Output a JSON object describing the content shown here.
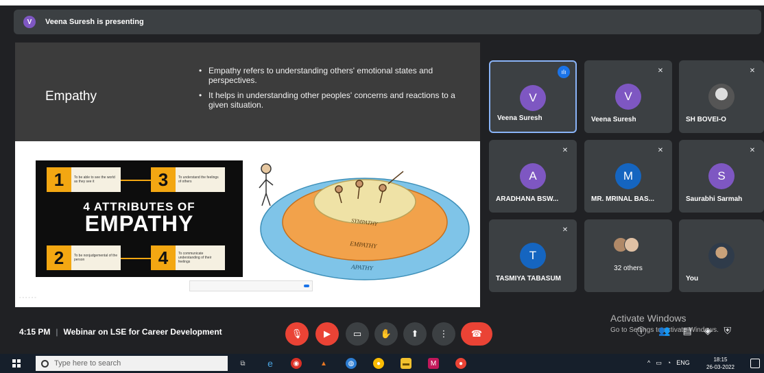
{
  "presenting": {
    "avatar_letter": "V",
    "text": "Veena Suresh is presenting"
  },
  "slide": {
    "title": "Empathy",
    "bullets": [
      "Empathy refers to understanding others' emotional states and perspectives.",
      "It helps in understanding other peoples' concerns and reactions to a given situation."
    ],
    "poster": {
      "line1": "4 ATTRIBUTES OF",
      "line2": "EMPATHY",
      "items": [
        {
          "num": "1",
          "text": "To be able to see the world as they see it"
        },
        {
          "num": "2",
          "text": "To be nonjudgemental of the person"
        },
        {
          "num": "3",
          "text": "To understand the feelings of others"
        },
        {
          "num": "4",
          "text": "To communicate understanding of their feelings"
        }
      ]
    },
    "circles": {
      "inner": "SYMPATHY",
      "middle": "EMPATHY",
      "outer": "APATHY"
    }
  },
  "participants": [
    {
      "name": "Veena Suresh",
      "letter": "V",
      "color": "#7e57c2",
      "active": true
    },
    {
      "name": "Veena Suresh",
      "letter": "V",
      "color": "#7e57c2"
    },
    {
      "name": "SH BOVEI-O",
      "letter": "",
      "photo": true
    },
    {
      "name": "ARADHANA BSW...",
      "letter": "A",
      "color": "#7e57c2"
    },
    {
      "name": "MR. MRINAL BAS...",
      "letter": "M",
      "color": "#1565c0"
    },
    {
      "name": "Saurabhi Sarmah",
      "letter": "S",
      "color": "#7e57c2"
    },
    {
      "name": "TASMIYA TABASUM",
      "letter": "T",
      "color": "#1565c0"
    },
    {
      "name": "32 others"
    },
    {
      "name": "You",
      "photo": true
    }
  ],
  "meeting": {
    "time": "4:15 PM",
    "title": "Webinar on LSE for Career Development"
  },
  "watermark": {
    "line1": "Activate Windows",
    "line2": "Go to Settings to activate Windows."
  },
  "taskbar": {
    "search_placeholder": "Type here to search",
    "lang": "ENG",
    "time": "18:15",
    "date": "26-03-2022"
  },
  "icons": [
    "mic-off-icon",
    "camera-off-icon",
    "captions-icon",
    "raise-hand-icon",
    "present-icon",
    "more-icon",
    "end-call-icon"
  ]
}
